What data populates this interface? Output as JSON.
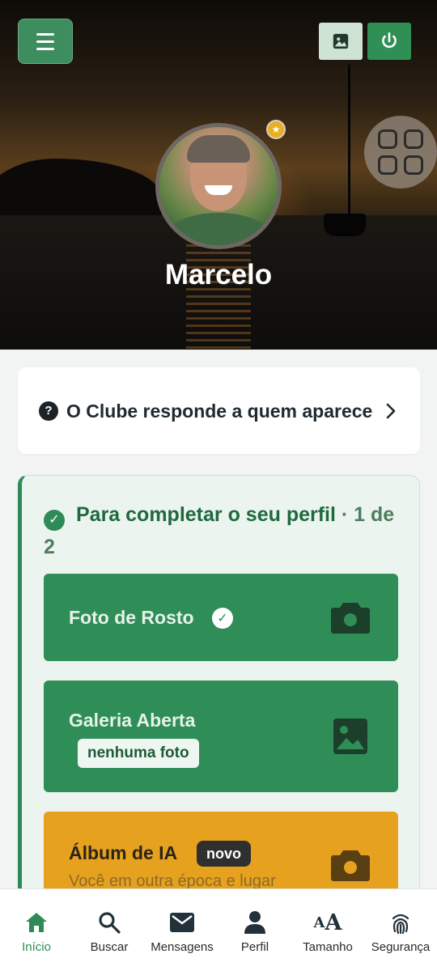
{
  "header": {
    "user_name": "Marcelo"
  },
  "info_card": {
    "text": "O Clube responde a quem aparece"
  },
  "profile_completion": {
    "title": "Para completar o seu perfil",
    "progress": "· 1 de 2",
    "tasks": [
      {
        "label": "Foto de Rosto",
        "completed": true,
        "icon": "camera-icon"
      },
      {
        "label": "Galeria Aberta",
        "chip": "nenhuma foto",
        "icon": "image-icon"
      },
      {
        "label": "Álbum de IA",
        "badge": "novo",
        "subtitle": "Você em outra época e lugar",
        "icon": "camera-icon"
      }
    ]
  },
  "bottom_nav": {
    "items": [
      {
        "label": "Início",
        "icon": "home-icon",
        "active": true
      },
      {
        "label": "Buscar",
        "icon": "search-icon"
      },
      {
        "label": "Mensagens",
        "icon": "mail-icon"
      },
      {
        "label": "Perfil",
        "icon": "person-icon"
      },
      {
        "label": "Tamanho",
        "icon": "text-size-icon"
      },
      {
        "label": "Segurança",
        "icon": "fingerprint-icon"
      }
    ]
  },
  "colors": {
    "accent": "#2e8b57",
    "warning": "#e6a11e",
    "star": "#e8b024"
  }
}
